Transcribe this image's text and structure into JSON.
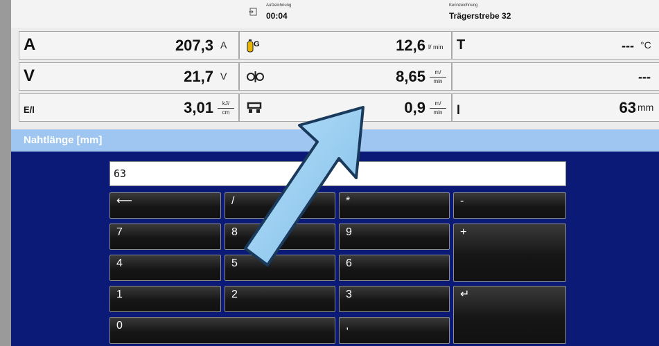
{
  "header": {
    "recording_caption": "Aufzeichnung",
    "recording_time": "00:04",
    "id_caption": "Kennzeichnung",
    "id_value": "Trägerstrebe 32"
  },
  "grid": {
    "current": {
      "symbol": "A",
      "value": "207,3",
      "unit": "A"
    },
    "gas_flow": {
      "symbol": "G",
      "value": "12,6",
      "unit": "l/ min"
    },
    "temperature": {
      "symbol": "T",
      "value": "---",
      "unit": "°C"
    },
    "voltage": {
      "symbol": "V",
      "value": "21,7",
      "unit": "V"
    },
    "wire_feed": {
      "value": "8,65",
      "unit_num": "m/",
      "unit_den": "min"
    },
    "empty": {
      "value": "---"
    },
    "energy": {
      "symbol": "E/l",
      "value": "3,01",
      "unit_num": "kJ/",
      "unit_den": "cm"
    },
    "travel_speed": {
      "value": "0,9",
      "unit_num": "m/",
      "unit_den": "min"
    },
    "length": {
      "symbol": "l",
      "value": "63",
      "unit": "mm"
    }
  },
  "keypad": {
    "title": "Nahtlänge [mm]",
    "display_value": "63",
    "keys": {
      "backspace": "⟵",
      "divide": "/",
      "multiply": "*",
      "minus": "-",
      "k7": "7",
      "k8": "8",
      "k9": "9",
      "plus": "+",
      "k4": "4",
      "k5": "5",
      "k6": "6",
      "k1": "1",
      "k2": "2",
      "k3": "3",
      "enter": "↵",
      "k0": "0",
      "comma": ","
    }
  },
  "colors": {
    "panel_bg": "#0a1a76",
    "title_bg": "#9ec6f0",
    "arrow_fill": "#8cc8f0",
    "arrow_stroke": "#1a3a5c"
  },
  "icons": {
    "current": "ampere-icon",
    "gas": "gas-bottle-icon",
    "wire": "wire-feed-rollers-icon",
    "travel": "carriage-icon"
  }
}
